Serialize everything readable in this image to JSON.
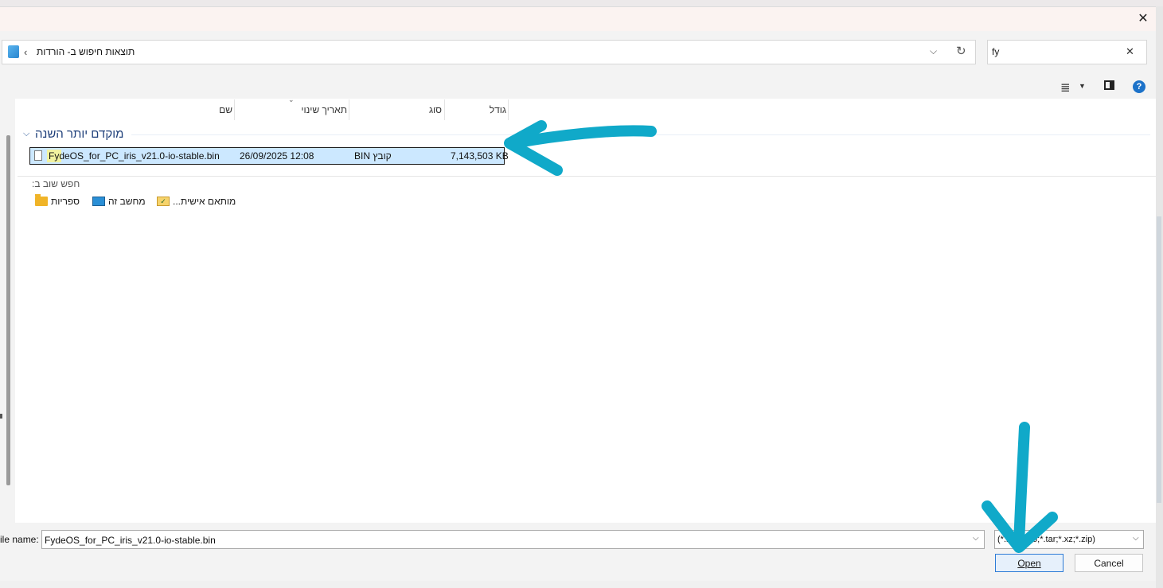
{
  "dialog": {
    "close_glyph": "✕"
  },
  "address": {
    "icon": "search-results-icon",
    "chevron": "‹",
    "path_text": "תוצאות חיפוש ב- הורדות",
    "dropdown_glyph": "⌵",
    "refresh_glyph": "↻"
  },
  "search": {
    "value": "fy",
    "clear_glyph": "✕"
  },
  "toolbar": {
    "view_glyph": "≣",
    "view_dd": "▼",
    "help_glyph": "?"
  },
  "columns": {
    "name": "שם",
    "date": "תאריך שינוי",
    "type": "סוג",
    "size": "גודל",
    "sort_glyph": "⌄"
  },
  "group": {
    "chevron": "⌵",
    "title": "מוקדם יותר השנה"
  },
  "files": [
    {
      "name": "FydeOS_for_PC_iris_v21.0-io-stable.bin",
      "date": "26/09/2025 12:08",
      "type": "BIN קובץ",
      "size": "7,143,503 KB"
    }
  ],
  "search_again": {
    "label": ":חפש שוב ב",
    "locations": [
      "ספריות",
      "מחשב זה",
      "...מותאם אישית"
    ]
  },
  "bottom": {
    "file_name_label": "ile name:",
    "file_name_value": "FydeOS_for_PC_iris_v21.0-io-stable.bin",
    "file_type_value": "(*.bin;*.iso;*.tar;*.xz;*.zip)",
    "open_label": "Open",
    "cancel_label": "Cancel",
    "dd_glyph": "⌵"
  },
  "colors": {
    "selection": "#cce8ff",
    "annotation": "#10a9c9",
    "accent": "#1c72c9"
  }
}
